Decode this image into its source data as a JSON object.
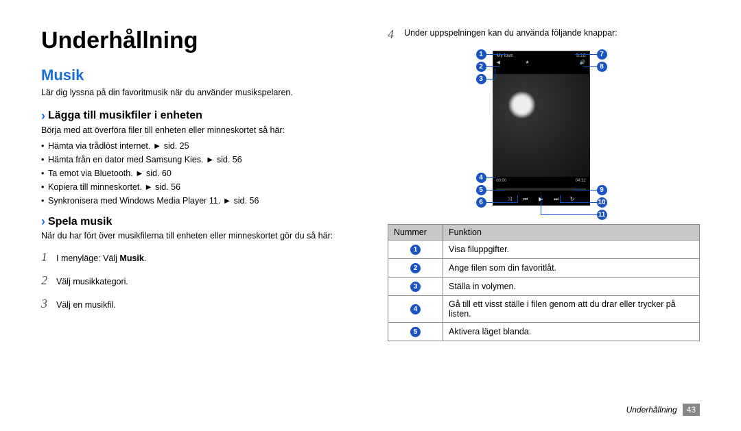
{
  "page_title": "Underhållning",
  "section_title": "Musik",
  "intro": "Lär dig lyssna på din favoritmusik när du använder musikspelaren.",
  "sub1_title": "Lägga till musikfiler i enheten",
  "sub1_intro": "Börja med att överföra filer till enheten eller minneskortet så här:",
  "bullets": [
    {
      "text": "Hämta via trådlöst internet. ► sid. 25"
    },
    {
      "text": "Hämta från en dator med Samsung Kies. ► sid. 56"
    },
    {
      "text": "Ta emot via Bluetooth. ► sid. 60"
    },
    {
      "text": "Kopiera till minneskortet. ► sid. 56"
    },
    {
      "text": "Synkronisera med Windows Media Player 11. ► sid. 56"
    }
  ],
  "sub2_title": "Spela musik",
  "sub2_intro": "När du har fört över musikfilerna till enheten eller minneskortet gör du så här:",
  "steps": [
    {
      "num": "1",
      "pre": "I menyläge: Välj ",
      "bold": "Musik",
      "post": "."
    },
    {
      "num": "2",
      "pre": "Välj musikkategori.",
      "bold": "",
      "post": ""
    },
    {
      "num": "3",
      "pre": "Välj en musikfil.",
      "bold": "",
      "post": ""
    }
  ],
  "right_step_num": "4",
  "right_step_text": "Under uppspelningen kan du använda följande knappar:",
  "screen": {
    "title_text": "My love",
    "time_right": "5.10",
    "elapsed": "00:00",
    "total": "04:32"
  },
  "callout_labels": {
    "l1": "1",
    "l2": "2",
    "l3": "3",
    "l4": "4",
    "l5": "5",
    "l6": "6",
    "r7": "7",
    "r8": "8",
    "r9": "9",
    "r10": "10",
    "r11": "11"
  },
  "table": {
    "header_number": "Nummer",
    "header_function": "Funktion",
    "rows": [
      {
        "n": "1",
        "f": "Visa filuppgifter."
      },
      {
        "n": "2",
        "f": "Ange filen som din favoritlåt."
      },
      {
        "n": "3",
        "f": "Ställa in volymen."
      },
      {
        "n": "4",
        "f": "Gå till ett visst ställe i filen genom att du drar eller trycker på listen."
      },
      {
        "n": "5",
        "f": "Aktivera läget blanda."
      }
    ]
  },
  "footer_section": "Underhållning",
  "footer_page": "43"
}
